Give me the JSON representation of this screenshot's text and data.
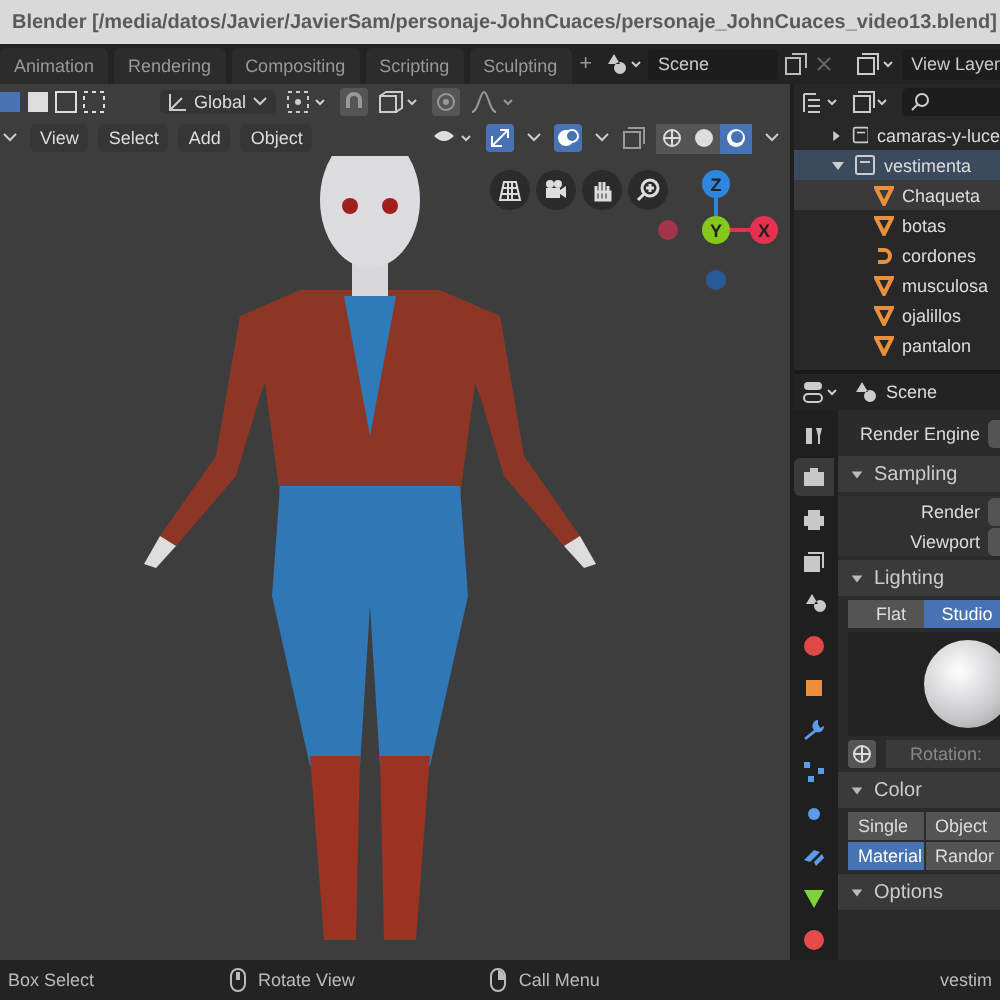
{
  "window": {
    "title": "Blender [/media/datos/Javier/JavierSam/personaje-JohnCuaces/personaje_JohnCuaces_video13.blend]"
  },
  "workspace_tabs": [
    {
      "label": "Animation",
      "selected": false
    },
    {
      "label": "Rendering",
      "selected": false
    },
    {
      "label": "Compositing",
      "selected": false
    },
    {
      "label": "Scripting",
      "selected": false
    },
    {
      "label": "Sculpting",
      "selected": false
    }
  ],
  "add_workspace": "+",
  "scene": "Scene",
  "view_layer": "View Layer",
  "viewport": {
    "orientation": "Global",
    "menus": [
      "View",
      "Select",
      "Add",
      "Object"
    ],
    "gizmo_toggle": {
      "on": true
    },
    "overlay_toggle": {
      "on": true
    },
    "shading_modes": [
      {
        "kind": "wireframe",
        "selected": false
      },
      {
        "kind": "solid",
        "selected": false
      },
      {
        "kind": "material",
        "selected": true
      }
    ],
    "gizmo_axes": [
      {
        "label": "Z",
        "color": "#2e86de"
      },
      {
        "label": "Y",
        "color": "#86c71b"
      },
      {
        "label": "X",
        "color": "#e5304f"
      }
    ]
  },
  "outliner": {
    "items": [
      {
        "label": "camaras-y-luce",
        "expanded": false,
        "selected": false
      },
      {
        "label": "vestimenta",
        "expanded": true,
        "selected": true,
        "children": [
          {
            "label": "Chaqueta",
            "kind": "mesh",
            "selected": true
          },
          {
            "label": "botas",
            "kind": "mesh",
            "selected": false
          },
          {
            "label": "cordones",
            "kind": "curve",
            "selected": false
          },
          {
            "label": "musculosa",
            "kind": "mesh",
            "selected": false
          },
          {
            "label": "ojalillos",
            "kind": "mesh",
            "selected": false
          },
          {
            "label": "pantalon",
            "kind": "mesh",
            "selected": false
          }
        ]
      }
    ]
  },
  "properties": {
    "scene": "Scene",
    "tabs": [
      {
        "kind": "tool",
        "selected": false
      },
      {
        "kind": "render",
        "selected": true
      },
      {
        "kind": "output",
        "selected": false
      },
      {
        "kind": "view_layer",
        "selected": false
      },
      {
        "kind": "scene",
        "selected": false
      },
      {
        "kind": "world",
        "selected": false
      },
      {
        "kind": "object",
        "selected": false
      },
      {
        "kind": "modifiers",
        "selected": false
      },
      {
        "kind": "particles",
        "selected": false
      },
      {
        "kind": "physics",
        "selected": false
      },
      {
        "kind": "constraints",
        "selected": false
      },
      {
        "kind": "data",
        "selected": false
      },
      {
        "kind": "material",
        "selected": false
      }
    ],
    "render_engine_label": "Render Engine",
    "sampling": {
      "title": "Sampling",
      "fields": [
        "Render",
        "Viewport"
      ]
    },
    "lighting": {
      "title": "Lighting",
      "options": [
        {
          "label": "Flat",
          "selected": false
        },
        {
          "label": "Studio",
          "selected": true
        }
      ],
      "rotation_label": "Rotation:"
    },
    "color": {
      "title": "Color",
      "options": [
        {
          "label": "Single",
          "selected": false
        },
        {
          "label": "Object",
          "selected": false
        },
        {
          "label": "Material",
          "selected": true
        },
        {
          "label": "Randor",
          "selected": false
        }
      ]
    },
    "options": {
      "title": "Options"
    }
  },
  "status_bar": {
    "hints": [
      {
        "kind": "none",
        "label": "Box Select"
      },
      {
        "kind": "middle",
        "label": "Rotate View"
      },
      {
        "kind": "right",
        "label": "Call Menu"
      }
    ],
    "info": "vestim"
  }
}
